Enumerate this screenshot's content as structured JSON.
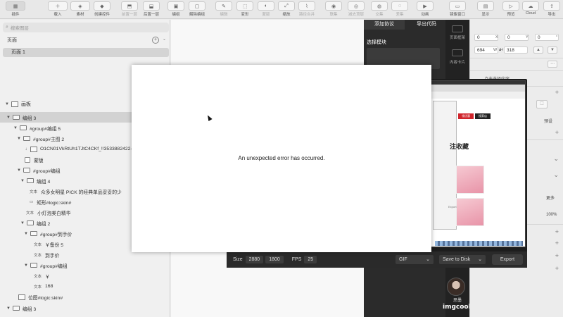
{
  "toolbar": {
    "items": [
      {
        "label": "插件",
        "icon": "insert-icon"
      },
      {
        "label": "载入",
        "icon": "plus-icon"
      },
      {
        "label": "素材",
        "icon": "cube-icon"
      },
      {
        "label": "创建控件",
        "icon": "component-icon"
      },
      {
        "label": "前置一层",
        "icon": "forward-icon"
      },
      {
        "label": "后置一层",
        "icon": "backward-icon"
      },
      {
        "label": "编组",
        "icon": "group-icon"
      },
      {
        "label": "解除编组",
        "icon": "ungroup-icon"
      },
      {
        "label": "编辑",
        "icon": "edit-icon"
      },
      {
        "label": "变形",
        "icon": "transform-icon"
      },
      {
        "label": "蒙版",
        "icon": "mask-icon"
      },
      {
        "label": "缩放",
        "icon": "scale-icon"
      },
      {
        "label": "路径合并",
        "icon": "path-icon"
      },
      {
        "label": "联集",
        "icon": "union-icon"
      },
      {
        "label": "减去顶层",
        "icon": "subtract-icon"
      },
      {
        "label": "交集",
        "icon": "intersect-icon"
      },
      {
        "label": "差集",
        "icon": "difference-icon"
      },
      {
        "label": "动画",
        "icon": "animation-icon"
      },
      {
        "label": "镜像窗口",
        "icon": "mirror-icon"
      },
      {
        "label": "显示",
        "icon": "view-icon"
      },
      {
        "label": "预览",
        "icon": "preview-icon"
      },
      {
        "label": "Cloud",
        "icon": "cloud-icon"
      },
      {
        "label": "导出",
        "icon": "export-icon"
      }
    ]
  },
  "left": {
    "search_placeholder": "搜索图层",
    "pages_header": "页面",
    "page_1": "页面 1",
    "layers_header": "画板",
    "rows": [
      {
        "label": "编组 3"
      },
      {
        "label": "#group#编组 5"
      },
      {
        "label": "#group#主图 2"
      },
      {
        "label": "O1CN01VkRtUh1TJtC4CKf_!!3533882422-0-..."
      },
      {
        "label": "蒙版"
      },
      {
        "label": "#group#编组"
      },
      {
        "label": "编组 4"
      },
      {
        "label": "众多女明星 PICK 的经典单品妥妥的少"
      },
      {
        "label": "矩形#logic:skin#"
      },
      {
        "label": "小灯泡美白精华"
      },
      {
        "label": "编组 2"
      },
      {
        "label": "#group#到手价"
      },
      {
        "label": "￥备份 5"
      },
      {
        "label": "到手价"
      },
      {
        "label": "#group#编组"
      },
      {
        "label": "￥"
      },
      {
        "label": "168"
      },
      {
        "label": "位图#logic:skin#"
      },
      {
        "label": "编组 3"
      }
    ],
    "text_tag": "文本"
  },
  "dark_panel": {
    "tab_1": "添加协议",
    "tab_2": "导出代码",
    "section": "选择模块",
    "side_1": "页面框架",
    "side_2": "内容卡片",
    "user_name": "思墨",
    "logo": "imgcook"
  },
  "inspector": {
    "x": "0",
    "x_label": "X",
    "y": "0",
    "y_label": "Y",
    "r": "0",
    "r_label": "°",
    "w": "694",
    "w_label": "W",
    "h": "318",
    "h_label": "H",
    "click_select": "点击选择内容",
    "preset": "预设",
    "more": "更多",
    "opacity": "100%"
  },
  "recorder": {
    "size_label": "Size",
    "width": "2880",
    "height": "1800",
    "fps_label": "FPS",
    "fps": "25",
    "format": "GIF",
    "save": "Save to Disk",
    "export": "Export",
    "shot_title": "注收藏",
    "shot_red": "领优惠",
    "shot_black": "搜索店",
    "shot_export": "Export"
  },
  "dialog": {
    "message": "An unexpected error has occurred."
  }
}
